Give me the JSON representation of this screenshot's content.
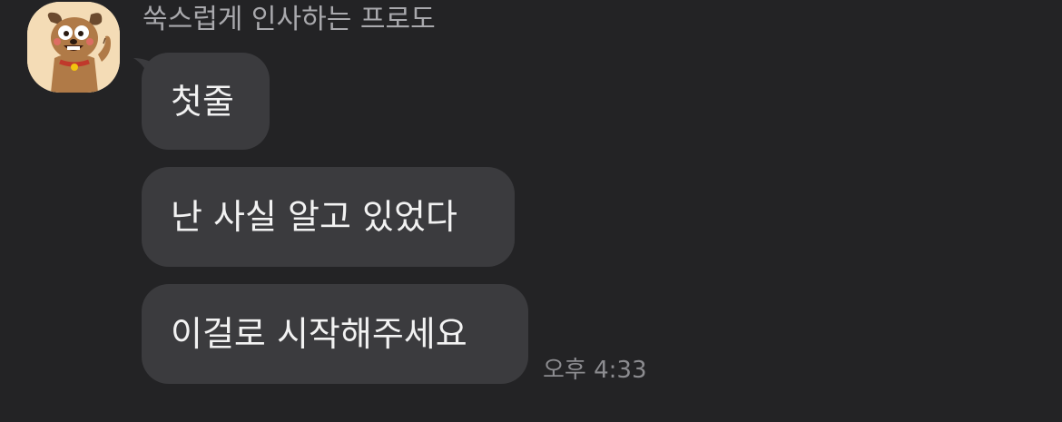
{
  "chat": {
    "sender_name": "쑥스럽게 인사하는 프로도",
    "avatar_icon": "frodo-dog-avatar-icon",
    "messages": [
      {
        "text": "첫줄"
      },
      {
        "text": "난 사실 알고 있었다"
      },
      {
        "text": "이걸로 시작해주세요"
      }
    ],
    "timestamp": "오후 4:33"
  },
  "colors": {
    "background": "#232325",
    "bubble": "#3b3b3e",
    "message_text": "#f2f2f2",
    "sender_text": "#a9a9ad",
    "timestamp_text": "#8c8c90"
  }
}
